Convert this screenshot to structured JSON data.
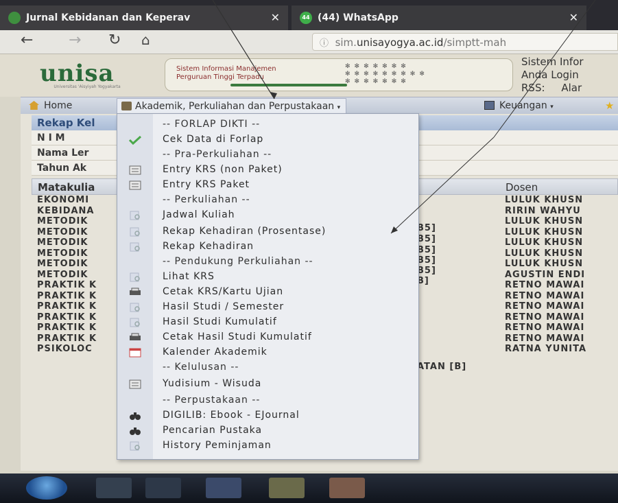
{
  "browser": {
    "tabs": [
      {
        "title": "Jurnal Kebidanan dan Keperav",
        "close": "✕"
      },
      {
        "title": "(44) WhatsApp",
        "close": "✕"
      }
    ],
    "badge": "44",
    "url_prefix": "sim.",
    "url_domain": "unisayogya.ac.id",
    "url_path": "/simptt-mah"
  },
  "header": {
    "logo": "unisa",
    "logo_sub": "Universitas 'Aisyiyah Yogyakarta",
    "banner_line1": "Sistem Informasi Manajemen",
    "banner_line2": "Perguruan Tinggi Terpadu",
    "sys_line1": "Sistem Infor",
    "sys_line2": "Anda Login",
    "sys_line3_label": "RSS:",
    "sys_line3_value": "Alar"
  },
  "menu": {
    "home": "Home",
    "akademik": "Akademik, Perkuliahan dan Perpustakaan",
    "keuangan": "Keuangan"
  },
  "panel": {
    "title": "Rekap Kel",
    "nim": "N I M",
    "nama": "Nama Ler",
    "tahun": "Tahun Ak"
  },
  "table": {
    "col_matakuliah": "Matakulia",
    "col_dosen": "Dosen",
    "mk": [
      "EKONOMI",
      "KEBIDANA",
      "METODIK",
      "METODIK",
      "METODIK",
      "METODIK",
      "METODIK",
      "METODIK",
      "PRAKTIK K",
      "PRAKTIK K",
      "PRAKTIK K",
      "PRAKTIK K",
      "PRAKTIK K",
      "PRAKTIK K",
      "PSIKOLOC"
    ],
    "mid": [
      "B5]",
      "B5]",
      "B5]",
      "B5]",
      "B5]",
      "B]",
      "ATAN [B]"
    ],
    "dosen": [
      "LULUK KHUSN",
      "RIRIN WAHYU",
      "LULUK KHUSN",
      "LULUK KHUSN",
      "LULUK KHUSN",
      "LULUK KHUSN",
      "LULUK KHUSN",
      "AGUSTIN ENDI",
      "RETNO MAWAI",
      "RETNO MAWAI",
      "RETNO MAWAI",
      "RETNO MAWAI",
      "RETNO MAWAI",
      "RETNO MAWAI",
      "RATNA YUNITA"
    ]
  },
  "dropdown": {
    "items": [
      {
        "label": "-- FORLAP DIKTI --",
        "icon": ""
      },
      {
        "label": "Cek Data di Forlap",
        "icon": "check-icon"
      },
      {
        "label": "-- Pra-Perkuliahan --",
        "icon": ""
      },
      {
        "label": "Entry KRS (non Paket)",
        "icon": "form-icon"
      },
      {
        "label": "Entry KRS Paket",
        "icon": "form-icon"
      },
      {
        "label": "-- Perkuliahan --",
        "icon": ""
      },
      {
        "label": "Jadwal Kuliah",
        "icon": "view-icon"
      },
      {
        "label": "Rekap Kehadiran (Prosentase)",
        "icon": "view-icon"
      },
      {
        "label": "Rekap Kehadiran",
        "icon": "view-icon"
      },
      {
        "label": "-- Pendukung Perkuliahan --",
        "icon": ""
      },
      {
        "label": "Lihat KRS",
        "icon": "view-icon"
      },
      {
        "label": "Cetak KRS/Kartu Ujian",
        "icon": "printer-icon"
      },
      {
        "label": "Hasil Studi / Semester",
        "icon": "view-icon"
      },
      {
        "label": "Hasil Studi Kumulatif",
        "icon": "view-icon"
      },
      {
        "label": "Cetak Hasil Studi Kumulatif",
        "icon": "printer-icon"
      },
      {
        "label": "Kalender Akademik",
        "icon": "calendar-icon"
      },
      {
        "label": "-- Kelulusan --",
        "icon": ""
      },
      {
        "label": "Yudisium - Wisuda",
        "icon": "form-icon"
      },
      {
        "label": "-- Perpustakaan --",
        "icon": ""
      },
      {
        "label": "DIGILIB: Ebook - EJournal",
        "icon": "binoculars-icon"
      },
      {
        "label": "Pencarian Pustaka",
        "icon": "binoculars-icon"
      },
      {
        "label": "History Peminjaman",
        "icon": "view-icon"
      }
    ]
  },
  "colors": {
    "accent": "#2f4d7a",
    "logo_green": "#2b6a3a"
  }
}
